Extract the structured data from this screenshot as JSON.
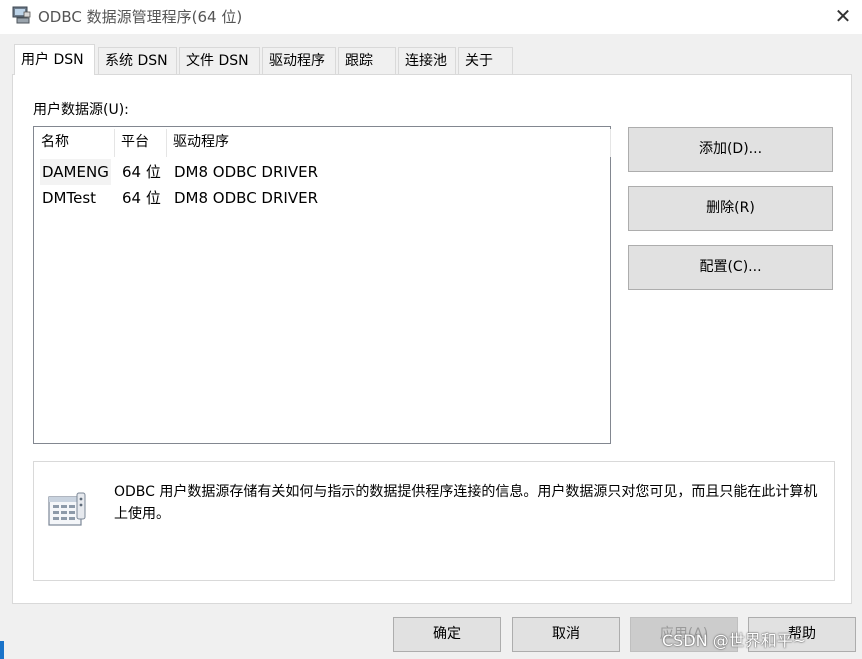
{
  "window": {
    "title": "ODBC 数据源管理程序(64 位)",
    "app_icon": "odbc-computer-icon",
    "close_icon": "close-icon"
  },
  "tabs": [
    {
      "label": "用户 DSN",
      "active": true
    },
    {
      "label": "系统 DSN",
      "active": false
    },
    {
      "label": "文件 DSN",
      "active": false
    },
    {
      "label": "驱动程序",
      "active": false
    },
    {
      "label": "跟踪",
      "active": false
    },
    {
      "label": "连接池",
      "active": false
    },
    {
      "label": "关于",
      "active": false
    }
  ],
  "user_dsn": {
    "section_label": "用户数据源(U):",
    "columns": [
      "名称",
      "平台",
      "驱动程序"
    ],
    "rows": [
      {
        "name": "DAMENG",
        "platform": "64 位",
        "driver": "DM8 ODBC DRIVER"
      },
      {
        "name": "DMTest",
        "platform": "64 位",
        "driver": "DM8 ODBC DRIVER"
      }
    ],
    "buttons": {
      "add": "添加(D)...",
      "remove": "删除(R)",
      "configure": "配置(C)..."
    },
    "info": {
      "icon": "data-source-icon",
      "text": "ODBC 用户数据源存储有关如何与指示的数据提供程序连接的信息。用户数据源只对您可见，而且只能在此计算机上使用。"
    }
  },
  "footer": {
    "ok": "确定",
    "cancel": "取消",
    "apply": "应用(A)",
    "help": "帮助"
  },
  "watermark": "CSDN @世界和平~",
  "colors": {
    "window_bg": "#f0f0f0",
    "panel_bg": "#ffffff",
    "button_bg": "#e1e1e1",
    "button_border": "#adadad",
    "list_border": "#828790"
  }
}
